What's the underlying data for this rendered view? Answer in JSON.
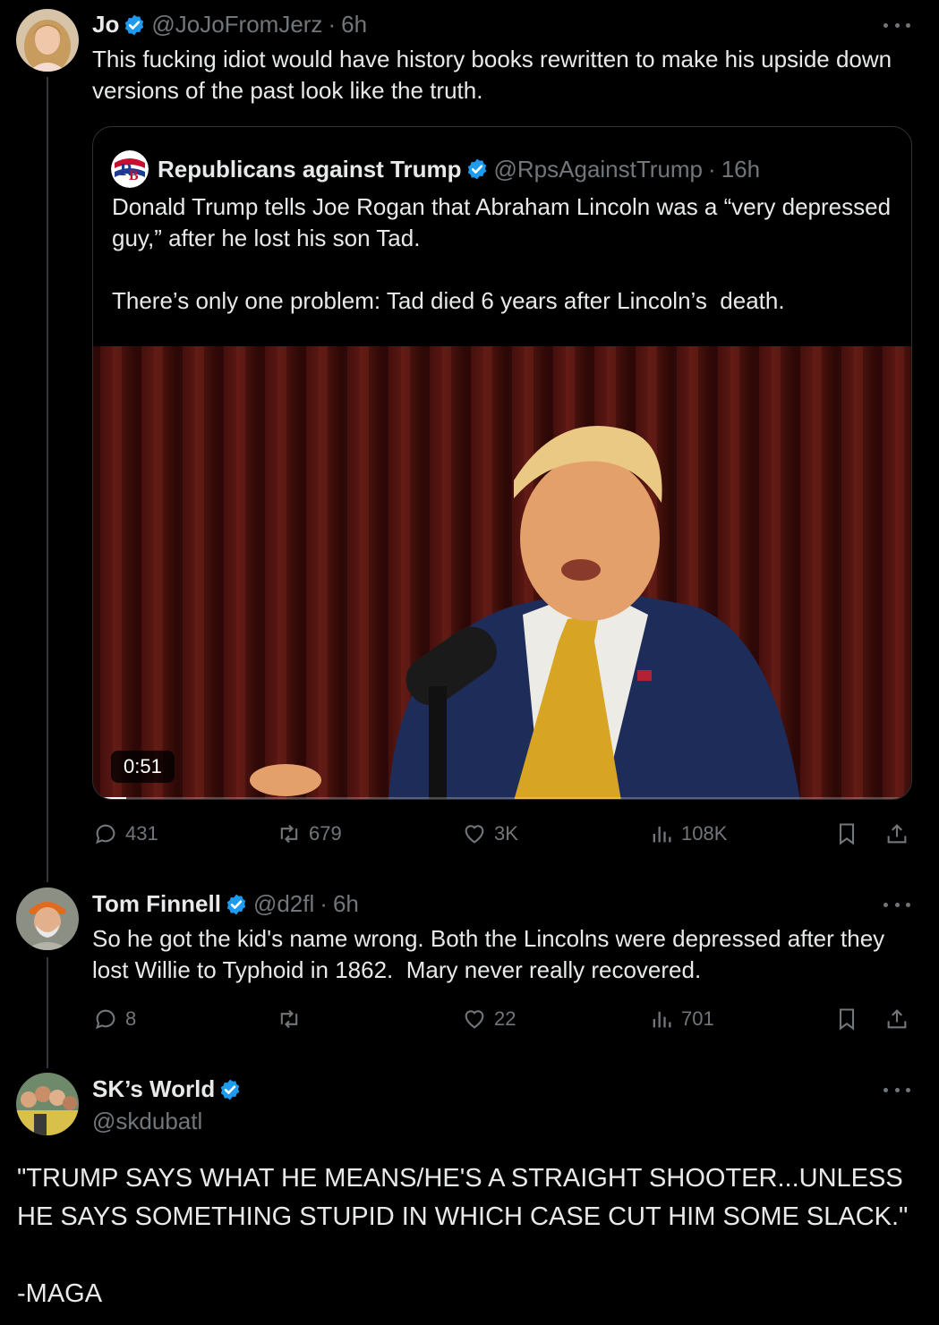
{
  "tweets": [
    {
      "name": "Jo",
      "handle": "@JoJoFromJerz",
      "time": "6h",
      "text": "This fucking idiot would have history books rewritten to make his upside down versions of the past look like the truth.",
      "quote": {
        "name": "Republicans against Trump",
        "handle": "@RpsAgainstTrump",
        "time": "16h",
        "text": "Donald Trump tells Joe Rogan that Abraham Lincoln was a “very depressed guy,” after he lost his son Tad.\n\nThere’s only one problem: Tad died 6 years after Lincoln’s  death.",
        "video_duration": "0:51",
        "video_progress": 0.04
      },
      "stats": {
        "replies": "431",
        "reposts": "679",
        "likes": "3K",
        "views": "108K"
      }
    },
    {
      "name": "Tom Finnell",
      "handle": "@d2fl",
      "time": "6h",
      "text": "So he got the kid's name wrong. Both the Lincolns were depressed after they lost Willie to Typhoid in 1862.  Mary never really recovered.",
      "stats": {
        "replies": "8",
        "reposts": "",
        "likes": "22",
        "views": "701"
      }
    },
    {
      "name": "SK’s World",
      "handle": "@skdubatl",
      "text": "\"TRUMP SAYS WHAT HE MEANS/HE'S A STRAIGHT SHOOTER...UNLESS HE SAYS SOMETHING STUPID IN WHICH CASE CUT HIM SOME SLACK.\"\n\n-MAGA"
    }
  ],
  "icons": {
    "verified": "verified-badge-icon",
    "reply": "reply-icon",
    "repost": "repost-icon",
    "like": "heart-icon",
    "views": "views-icon",
    "bookmark": "bookmark-icon",
    "share": "share-icon",
    "more": "more-icon"
  },
  "colors": {
    "background": "#000000",
    "text": "#e7e9ea",
    "muted": "#71767b",
    "verified": "#1d9bf0",
    "border": "#2f3336"
  }
}
